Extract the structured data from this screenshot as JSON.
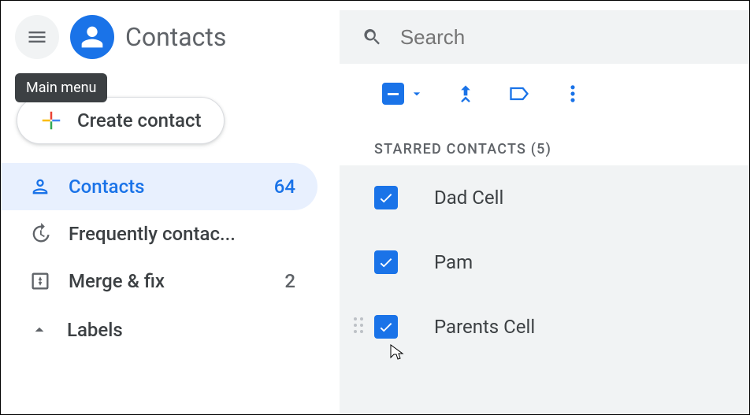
{
  "app": {
    "title": "Contacts"
  },
  "tooltip": {
    "main_menu": "Main menu"
  },
  "create": {
    "label": "Create contact"
  },
  "nav": {
    "contacts": {
      "label": "Contacts",
      "count": "64"
    },
    "frequently": {
      "label": "Frequently contac..."
    },
    "merge": {
      "label": "Merge & fix",
      "count": "2"
    },
    "labels": {
      "label": "Labels"
    }
  },
  "search": {
    "placeholder": "Search"
  },
  "section": {
    "starred": "STARRED CONTACTS (5)"
  },
  "contacts": [
    {
      "name": "Dad Cell"
    },
    {
      "name": "Pam"
    },
    {
      "name": "Parents Cell"
    }
  ]
}
